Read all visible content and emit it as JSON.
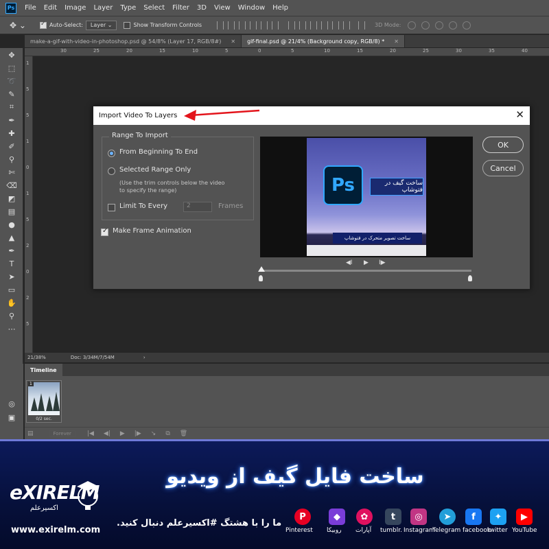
{
  "app": {
    "logo_text": "Ps"
  },
  "menu": [
    "File",
    "Edit",
    "Image",
    "Layer",
    "Type",
    "Select",
    "Filter",
    "3D",
    "View",
    "Window",
    "Help"
  ],
  "options": {
    "auto_select_label": "Auto-Select:",
    "auto_select_checked": true,
    "auto_select_target": "Layer",
    "show_transform_label": "Show Transform Controls",
    "mode_3d_label": "3D Mode:"
  },
  "tabs": [
    {
      "label": "make-a-gif-with-video-in-photoshop.psd @ 54/8% (Layer 17, RGB/8#)",
      "active": false
    },
    {
      "label": "gif-final.psd @ 21/4% (Background copy, RGB/8) *",
      "active": true
    }
  ],
  "ruler": {
    "top": [
      "30",
      "25",
      "20",
      "15",
      "10",
      "5",
      "0",
      "5",
      "10",
      "15",
      "20",
      "25",
      "30",
      "35",
      "40"
    ],
    "left": [
      "1",
      "5",
      "5",
      "1",
      "0",
      "1",
      "5",
      "2",
      "0",
      "2",
      "5"
    ]
  },
  "status": {
    "zoom": "21/38%",
    "doc": "Doc: 3/34M/7/54M",
    "arrow": "›"
  },
  "timeline": {
    "tab_label": "Timeline",
    "frame_number": "1",
    "frame_delay": "0/2 sec.",
    "loop_option": "Forever"
  },
  "dialog": {
    "title": "Import Video To Layers",
    "close_glyph": "✕",
    "range_group_label": "Range To Import",
    "option_from_beginning": "From Beginning To End",
    "option_selected_range": "Selected Range Only",
    "selected_range_hint": "(Use the trim controls below the video to specify the range)",
    "limit_label": "Limit To Every",
    "limit_value": "2",
    "frames_label": "Frames",
    "make_frame_animation_label": "Make Frame Animation",
    "make_frame_animation_checked": true,
    "ok_label": "OK",
    "cancel_label": "Cancel",
    "selected_option": "from_beginning",
    "preview": {
      "icon_text": "Ps",
      "caption_main": "ساخت گیف در فتوشاپ",
      "caption_sub": "ساخت تصویر متحرک در فتوشاپ"
    },
    "playback": {
      "prev": "◀I",
      "play": "▶",
      "next": "I▶"
    }
  },
  "banner": {
    "title": "ساخت فایل گیف از ویدیو",
    "subtitle": "ما را با هشتگ #اکسیرعلم دنبال کنید.",
    "brand_name": "eXIRELM",
    "brand_name_fa": "اکسیرعلم",
    "brand_url": "www.exirelm.com",
    "socials": [
      {
        "name": "Pinterest",
        "glyph": "P",
        "color": "#e60023"
      },
      {
        "name": "روبیکا",
        "glyph": "◆",
        "color": "#7a3dd8"
      },
      {
        "name": "آپارات",
        "glyph": "✿",
        "color": "#e0115f"
      },
      {
        "name": "tumblr.",
        "glyph": "t",
        "color": "#36465d"
      },
      {
        "name": "Instagram",
        "glyph": "◎",
        "color": "#c13584"
      },
      {
        "name": "Telegram",
        "glyph": "➤",
        "color": "#229ed9"
      },
      {
        "name": "facebook",
        "glyph": "f",
        "color": "#1877f2"
      },
      {
        "name": "twitter",
        "glyph": "✦",
        "color": "#1da1f2"
      },
      {
        "name": "YouTube",
        "glyph": "▶",
        "color": "#ff0000"
      }
    ]
  }
}
